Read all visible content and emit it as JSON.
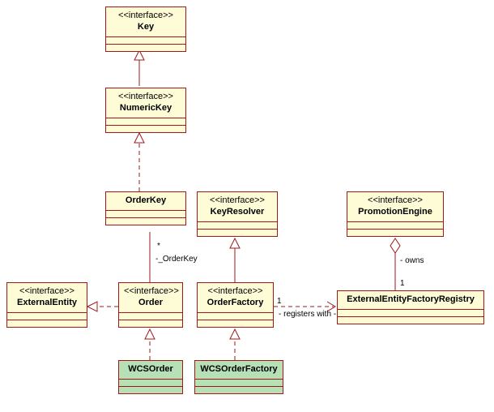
{
  "stereotypes": {
    "iface": "<<interface>>"
  },
  "nodes": {
    "key": {
      "name": "Key"
    },
    "numericKey": {
      "name": "NumericKey"
    },
    "orderKey": {
      "name": "OrderKey"
    },
    "keyResolver": {
      "name": "KeyResolver"
    },
    "promoEngine": {
      "name": "PromotionEngine"
    },
    "extEntity": {
      "name": "ExternalEntity"
    },
    "order": {
      "name": "Order"
    },
    "orderFactory": {
      "name": "OrderFactory"
    },
    "eefRegistry": {
      "name": "ExternalEntityFactoryRegistry"
    },
    "wcsOrder": {
      "name": "WCSOrder"
    },
    "wcsOrderFac": {
      "name": "WCSOrderFactory"
    }
  },
  "edgeLabels": {
    "orderKeyAgg": {
      "role": "-_OrderKey",
      "mult": "*"
    },
    "owns": {
      "role": "- owns",
      "mult": "1"
    },
    "registersWith": {
      "role": "- registers with -",
      "mult": "1"
    }
  },
  "chart_data": {
    "type": "uml-class",
    "title": "",
    "classes": [
      {
        "id": "Key",
        "stereotype": "interface"
      },
      {
        "id": "NumericKey",
        "stereotype": "interface"
      },
      {
        "id": "OrderKey",
        "stereotype": null
      },
      {
        "id": "KeyResolver",
        "stereotype": "interface"
      },
      {
        "id": "PromotionEngine",
        "stereotype": "interface"
      },
      {
        "id": "ExternalEntity",
        "stereotype": "interface"
      },
      {
        "id": "Order",
        "stereotype": "interface"
      },
      {
        "id": "OrderFactory",
        "stereotype": "interface"
      },
      {
        "id": "ExternalEntityFactoryRegistry",
        "stereotype": null
      },
      {
        "id": "WCSOrder",
        "stereotype": null,
        "concrete": true
      },
      {
        "id": "WCSOrderFactory",
        "stereotype": null,
        "concrete": true
      }
    ],
    "relations": [
      {
        "type": "generalization",
        "from": "NumericKey",
        "to": "Key"
      },
      {
        "type": "realization",
        "from": "OrderKey",
        "to": "NumericKey"
      },
      {
        "type": "generalization",
        "from": "OrderFactory",
        "to": "KeyResolver"
      },
      {
        "type": "realization",
        "from": "WCSOrder",
        "to": "Order"
      },
      {
        "type": "realization",
        "from": "WCSOrderFactory",
        "to": "OrderFactory"
      },
      {
        "type": "realization",
        "from": "Order",
        "to": "ExternalEntity"
      },
      {
        "type": "aggregation",
        "from": "Order",
        "to": "OrderKey",
        "role": "_OrderKey",
        "mult_to": "*"
      },
      {
        "type": "aggregation",
        "from": "PromotionEngine",
        "to": "ExternalEntityFactoryRegistry",
        "role": "owns",
        "mult_to": "1"
      },
      {
        "type": "association",
        "from": "OrderFactory",
        "to": "ExternalEntityFactoryRegistry",
        "role": "registers with",
        "mult_to": "1"
      }
    ]
  }
}
